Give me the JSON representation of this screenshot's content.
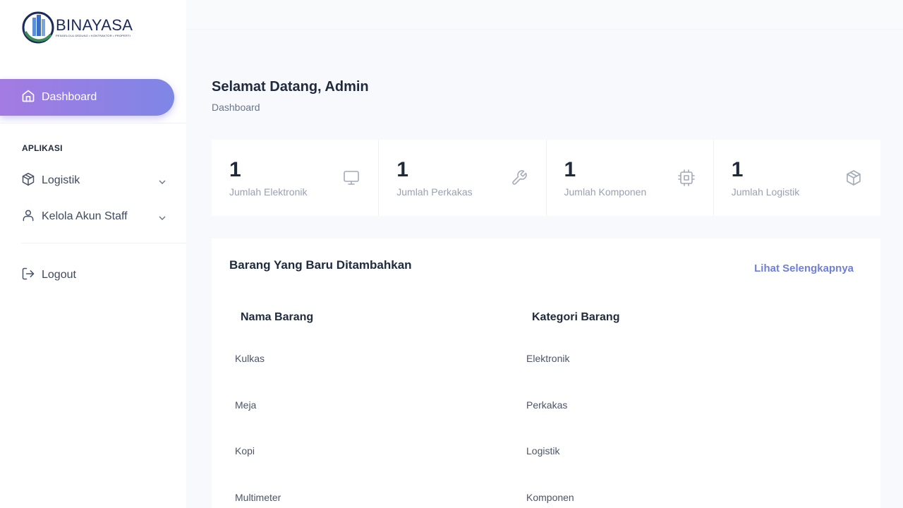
{
  "brand": {
    "name": "BINAYASA",
    "tagline": "PENGELOLA GEDUNG • KONTRAKTOR • PROPERTI"
  },
  "sidebar": {
    "active_item": {
      "label": "Dashboard",
      "icon": "home-icon"
    },
    "section_title": "APLIKASI",
    "items": [
      {
        "label": "Logistik",
        "icon": "box-icon",
        "expandable": true
      },
      {
        "label": "Kelola Akun Staff",
        "icon": "user-icon",
        "expandable": true
      }
    ],
    "logout": {
      "label": "Logout",
      "icon": "logout-icon"
    }
  },
  "header": {
    "title": "Selamat Datang, Admin",
    "breadcrumb": "Dashboard"
  },
  "stats": [
    {
      "value": "1",
      "label": "Jumlah Elektronik",
      "icon": "monitor-icon"
    },
    {
      "value": "1",
      "label": "Jumlah Perkakas",
      "icon": "wrench-icon"
    },
    {
      "value": "1",
      "label": "Jumlah Komponen",
      "icon": "cpu-icon"
    },
    {
      "value": "1",
      "label": "Jumlah Logistik",
      "icon": "package-icon"
    }
  ],
  "recent": {
    "title": "Barang Yang Baru Ditambahkan",
    "link": "Lihat Selengkapnya",
    "columns": [
      "Nama Barang",
      "Kategori Barang"
    ],
    "rows": [
      [
        "Kulkas",
        "Elektronik"
      ],
      [
        "Meja",
        "Perkakas"
      ],
      [
        "Kopi",
        "Logistik"
      ],
      [
        "Multimeter",
        "Komponen"
      ]
    ]
  },
  "colors": {
    "accent_start": "#a47be2",
    "accent_end": "#7e86e6",
    "link": "#6f7fd8",
    "brand_navy": "#1b2a5e",
    "brand_green": "#3a8a5a"
  }
}
